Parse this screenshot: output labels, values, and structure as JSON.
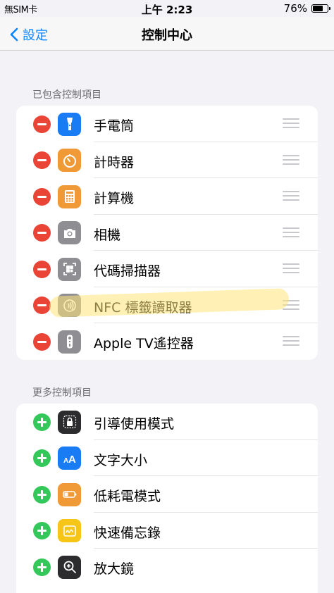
{
  "status_bar": {
    "carrier": "無SIM卡",
    "time": "上午 2:23",
    "battery": "76%",
    "battery_level": 0.76
  },
  "nav": {
    "back_label": "設定",
    "title": "控制中心"
  },
  "included": {
    "header": "已包含控制項目",
    "items": [
      {
        "label": "手電筒",
        "icon": "flashlight-icon",
        "color": "#1a7cf5"
      },
      {
        "label": "計時器",
        "icon": "timer-icon",
        "color": "#f09a37"
      },
      {
        "label": "計算機",
        "icon": "calculator-icon",
        "color": "#f09a37"
      },
      {
        "label": "相機",
        "icon": "camera-icon",
        "color": "#8e8e93"
      },
      {
        "label": "代碼掃描器",
        "icon": "qr-scanner-icon",
        "color": "#8e8e93"
      },
      {
        "label": "NFC 標籤讀取器",
        "icon": "nfc-icon",
        "color": "#8e8e93"
      },
      {
        "label": "Apple TV遙控器",
        "icon": "tv-remote-icon",
        "color": "#8e8e93"
      }
    ]
  },
  "more": {
    "header": "更多控制項目",
    "items": [
      {
        "label": "引導使用模式",
        "icon": "lock-icon",
        "color": "#2c2c2e"
      },
      {
        "label": "文字大小",
        "icon": "text-size-icon",
        "color": "#1a7cf5"
      },
      {
        "label": "低耗電模式",
        "icon": "battery-icon",
        "color": "#f09a37"
      },
      {
        "label": "快速備忘錄",
        "icon": "quick-note-icon",
        "color": "#f5c518"
      },
      {
        "label": "放大鏡",
        "icon": "magnifier-icon",
        "color": "#2c2c2e"
      }
    ]
  },
  "colors": {
    "accent": "#0a84ff",
    "remove": "#ea4436",
    "add": "#34c759",
    "background": "#f2f2f7"
  }
}
